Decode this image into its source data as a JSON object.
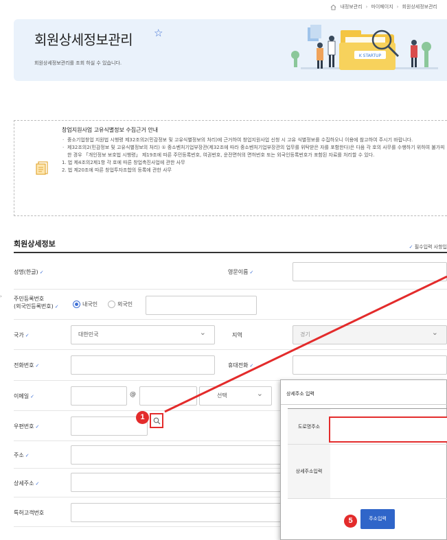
{
  "breadcrumb": [
    "내정보관리",
    "마이페이지",
    "회원상세정보관리"
  ],
  "banner": {
    "title": "회원상세정보관리",
    "subtitle": "회원상세정보관리를 조회 하실 수 있습니다.",
    "logo_text": "K STARTUP"
  },
  "notice": {
    "title": "창업지원사업 고유식별정보 수집근거 안내",
    "items": [
      "중소기업창업 지원법 시행령 제32조의2(민감정보 및 고유식별정보의 처리)에 근거하여 창업지원사업 신청 시 고유 식별정보를 수집하오니 이용에 참고하여 주시기 바랍니다.",
      "제32조의2(민감정보 및 고유식별정보의 처리) ① 중소벤처기업부장관(제32조에 따라 중소벤처기업부장관의 업무를 위탁받은 자를 포함한다)은 다음 각 호의 사무를 수행하기 위하여 불가피한 경우 「개인정보 보호법 시행령」 제19조에 따른 주민등록번호, 여권번호, 운전면허의 면허번호 또는 외국인등록번호가 포함된 자료를 처리할 수 있다."
    ],
    "numbered": [
      "1. 법 제4조의2제1항 각 호에 따른 창업촉진사업에 관한 사무",
      "2. 법 제20조에 따른 창업투자조합의 등록에 관한 사무"
    ]
  },
  "section": {
    "title": "회원상세정보",
    "required_note": "필수입력 사항입"
  },
  "form": {
    "name_label": "성명(한글)",
    "eng_name_label": "영문이름",
    "resident_label_1": "주민등록번호",
    "resident_label_2": "(외국인등록번호)",
    "radio_domestic": "내국인",
    "radio_foreign": "외국인",
    "country_label": "국가",
    "country_value": "대한민국",
    "region_label": "지역",
    "region_value": "경기",
    "phone_label": "전화번호",
    "mobile_label": "휴대전화",
    "email_label": "이메일",
    "email_at": "@",
    "email_select": "선택",
    "zip_label": "우편번호",
    "address_label": "주소",
    "detail_address_label": "상세주소",
    "patent_label": "특허고객번호"
  },
  "popup": {
    "title": "상세주소 입력",
    "road_label": "도로명주소",
    "detail_label": "상세주소입력",
    "confirm_label": "주소입력"
  },
  "annotations": {
    "step1": "1",
    "step5": "5",
    "color": "#e32b2b"
  }
}
